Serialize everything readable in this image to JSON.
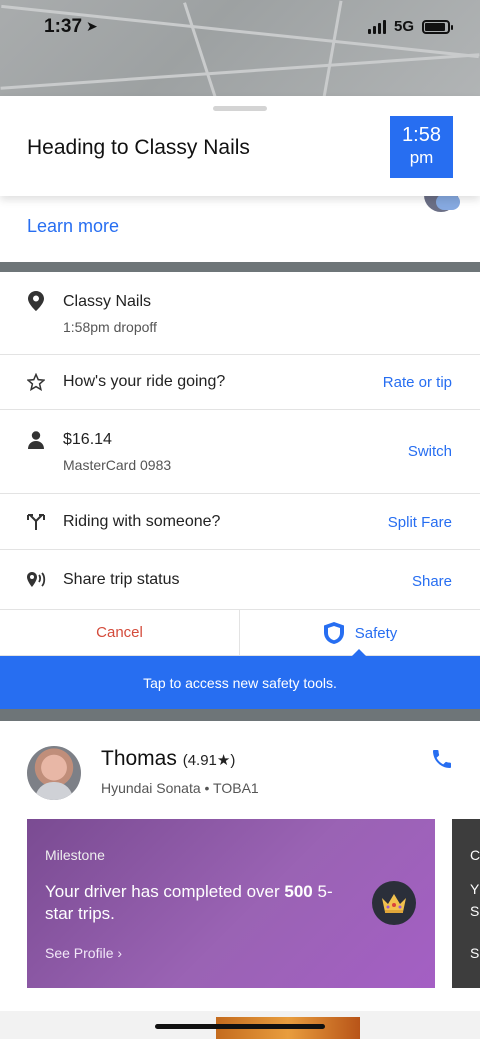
{
  "status_bar": {
    "time": "1:37",
    "network": "5G"
  },
  "header": {
    "title": "Heading to Classy Nails",
    "eta_time": "1:58",
    "eta_ampm": "pm"
  },
  "info": {
    "learn_more": "Learn more"
  },
  "rows": [
    {
      "icon": "location-pin-icon",
      "main": "Classy Nails",
      "sub": "1:58pm dropoff",
      "action": ""
    },
    {
      "icon": "star-icon",
      "main": "How's your ride going?",
      "sub": "",
      "action": "Rate or tip"
    },
    {
      "icon": "person-icon",
      "main": "$16.14",
      "sub": "MasterCard 0983",
      "action": "Switch"
    },
    {
      "icon": "split-icon",
      "main": "Riding with someone?",
      "sub": "",
      "action": "Split Fare"
    },
    {
      "icon": "share-location-icon",
      "main": "Share trip status",
      "sub": "",
      "action": "Share"
    }
  ],
  "buttons": {
    "cancel": "Cancel",
    "safety": "Safety"
  },
  "banner": {
    "text": "Tap to access new safety tools."
  },
  "driver": {
    "name": "Thomas",
    "rating": "(4.91★)",
    "car": "Hyundai Sonata • TOBA1"
  },
  "milestone": {
    "label": "Milestone",
    "message_pre": "Your driver has completed over ",
    "message_bold": "500",
    "message_post": " 5-star trips.",
    "link": "See Profile ›"
  },
  "next_card": {
    "label_1": "C",
    "label_2": "Y",
    "label_3": "S",
    "label_4": "S"
  },
  "colors": {
    "accent": "#276ef1",
    "cancel": "#d44b3b",
    "milestone": "#9a63b4"
  }
}
